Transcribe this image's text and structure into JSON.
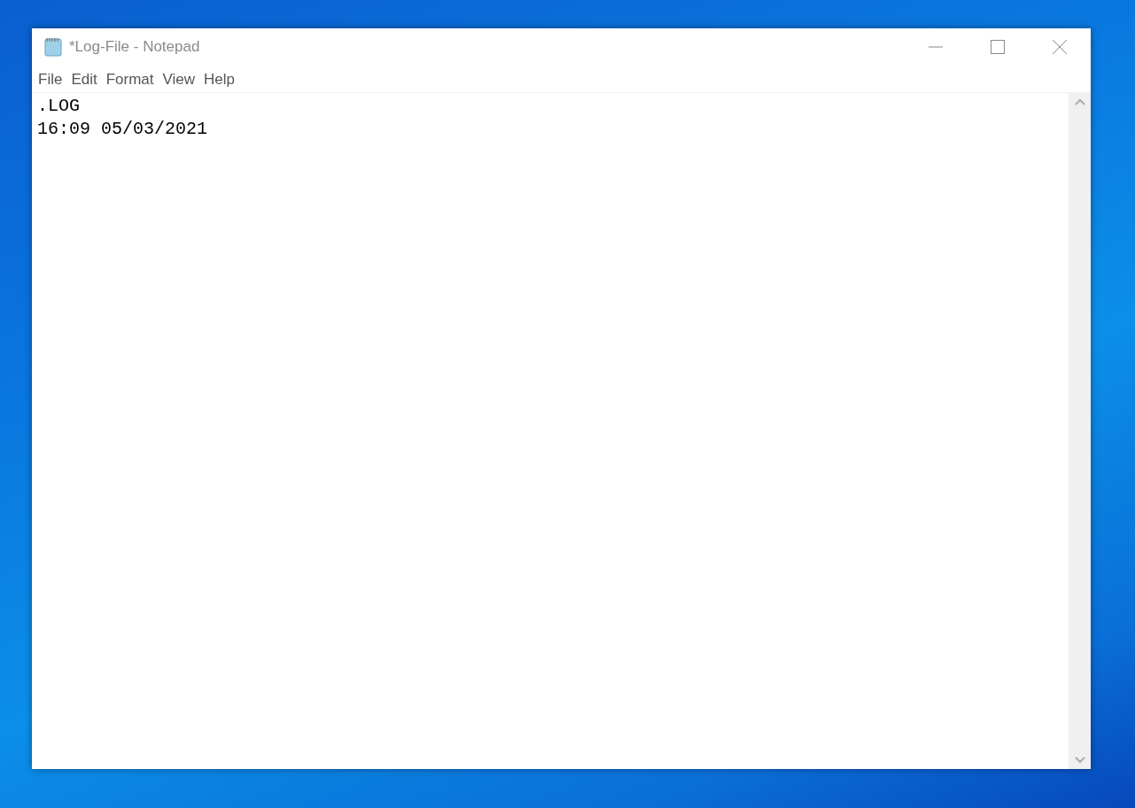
{
  "window": {
    "title": "*Log-File - Notepad"
  },
  "menu": [
    "File",
    "Edit",
    "Format",
    "View",
    "Help"
  ],
  "document": {
    "lines": [
      ".LOG",
      "16:09 05/03/2021"
    ]
  }
}
